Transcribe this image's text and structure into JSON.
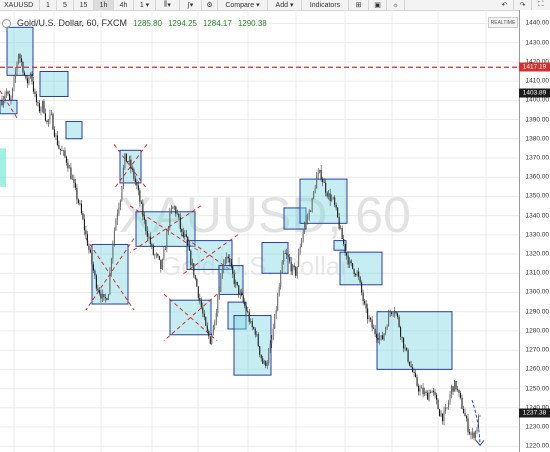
{
  "toolbar": {
    "symbol": "XAUUSD",
    "intervals": [
      "1",
      "5",
      "15",
      "1h",
      "4h",
      "1"
    ],
    "compare_label": "Compare",
    "add_label": "Add",
    "indicators_label": "Indicators"
  },
  "legend": {
    "title": "Gold/U.S. Dollar, 60, FXCM",
    "open": "1285.80",
    "high": "1294.25",
    "low": "1284.17",
    "close": "1290.38"
  },
  "watermark": "XAUUSD, 60",
  "watermark_sub": "Gold/U.S. Dollar",
  "realtime_label": "REALTIME",
  "price_axis": {
    "ticks": [
      "1440.00",
      "1430.00",
      "1420.00",
      "1410.00",
      "1400.00",
      "1390.00",
      "1380.00",
      "1370.00",
      "1360.00",
      "1350.00",
      "1340.00",
      "1330.00",
      "1320.00",
      "1310.00",
      "1300.00",
      "1290.00",
      "1280.00",
      "1270.00",
      "1260.00",
      "1250.00",
      "1240.00",
      "1230.00",
      "1220.00"
    ],
    "resistance_label": "1417.19",
    "marker_label": "1403.89",
    "last_price_label": "1237.38"
  },
  "chart_data": {
    "type": "candlestick",
    "symbol": "XAUUSD",
    "interval": "60",
    "ylim": [
      1217,
      1447
    ],
    "resistance_level": 1417.19,
    "marker_level": 1403.89,
    "last_price": 1237.38,
    "path": [
      1400,
      1405,
      1398,
      1410,
      1425,
      1418,
      1408,
      1415,
      1402,
      1395,
      1398,
      1388,
      1392,
      1382,
      1375,
      1372,
      1368,
      1360,
      1352,
      1345,
      1335,
      1325,
      1315,
      1305,
      1300,
      1295,
      1300,
      1325,
      1340,
      1350,
      1370,
      1368,
      1362,
      1355,
      1345,
      1335,
      1328,
      1320,
      1318,
      1312,
      1325,
      1340,
      1345,
      1340,
      1330,
      1328,
      1318,
      1310,
      1300,
      1290,
      1280,
      1275,
      1285,
      1300,
      1315,
      1320,
      1312,
      1305,
      1300,
      1295,
      1290,
      1282,
      1280,
      1270,
      1262,
      1265,
      1275,
      1290,
      1305,
      1320,
      1318,
      1312,
      1310,
      1325,
      1335,
      1340,
      1348,
      1360,
      1362,
      1355,
      1350,
      1348,
      1340,
      1330,
      1322,
      1315,
      1312,
      1310,
      1300,
      1290,
      1285,
      1280,
      1278,
      1275,
      1283,
      1290,
      1292,
      1285,
      1275,
      1268,
      1262,
      1255,
      1250,
      1248,
      1246,
      1250,
      1245,
      1238,
      1235,
      1240,
      1250,
      1252,
      1245,
      1238,
      1230,
      1225,
      1228,
      1237.38
    ],
    "zones": [
      {
        "p1": 1438,
        "p2": 1413,
        "cross": false
      },
      {
        "p1": 1415,
        "p2": 1402,
        "cross": false
      },
      {
        "p1": 1389,
        "p2": 1380,
        "cross": false
      },
      {
        "p1": 1374,
        "p2": 1357,
        "cross": true
      },
      {
        "p1": 1400,
        "p2": 1393,
        "cross": false
      },
      {
        "p1": 1325,
        "p2": 1294,
        "cross": true
      },
      {
        "p1": 1342,
        "p2": 1324,
        "cross": true
      },
      {
        "p1": 1327,
        "p2": 1312,
        "cross": true
      },
      {
        "p1": 1296,
        "p2": 1278,
        "cross": true
      },
      {
        "p1": 1314,
        "p2": 1299,
        "cross": false
      },
      {
        "p1": 1295,
        "p2": 1281,
        "cross": false
      },
      {
        "p1": 1288,
        "p2": 1257,
        "cross": false
      },
      {
        "p1": 1326,
        "p2": 1310,
        "cross": false
      },
      {
        "p1": 1344,
        "p2": 1333,
        "cross": false
      },
      {
        "p1": 1359,
        "p2": 1336,
        "cross": false
      },
      {
        "p1": 1327,
        "p2": 1322,
        "cross": false
      },
      {
        "p1": 1321,
        "p2": 1304,
        "cross": false
      },
      {
        "p1": 1290,
        "p2": 1260,
        "cross": false
      }
    ]
  }
}
